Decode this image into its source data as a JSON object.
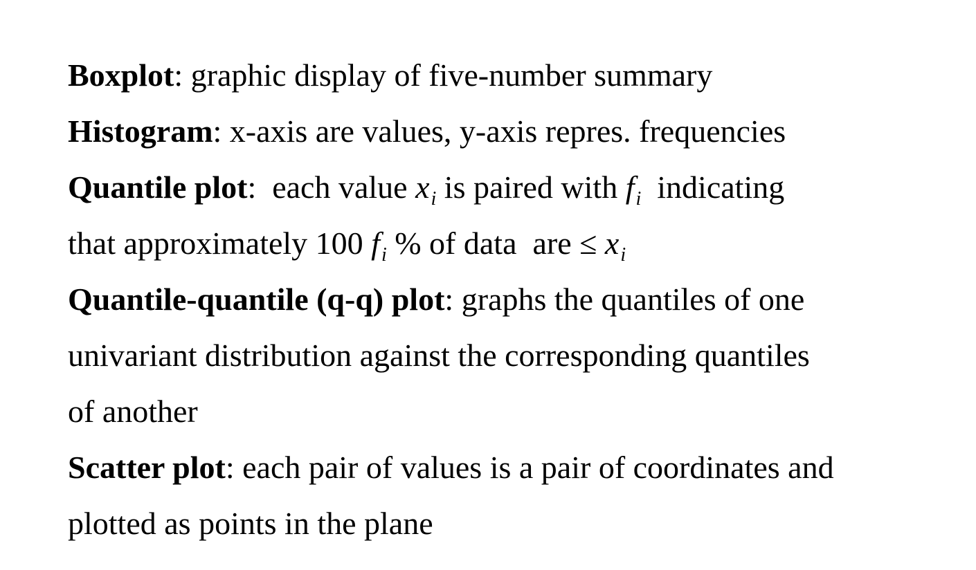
{
  "definitions": {
    "boxplot": {
      "term": "Boxplot",
      "sep": ":",
      "desc": " graphic display of five-number summary"
    },
    "histogram": {
      "term": "Histogram",
      "sep": ":",
      "desc": " x-axis are values, y-axis repres. frequencies"
    },
    "quantile": {
      "term": "Quantile plot",
      "sep": ":",
      "desc_a": "  each value ",
      "var_x": "x",
      "sub_i": "i",
      "desc_b": " is paired with ",
      "var_f": "f",
      "desc_c": "  indicating",
      "line2_a": "that approximately 100 ",
      "line2_b": " % of data  are ≤ "
    },
    "qq": {
      "term": "Quantile-quantile (q-q) plot",
      "sep": ":",
      "desc_1": " graphs the quantiles of one",
      "desc_2": "univariant distribution against the corresponding quantiles",
      "desc_3": "of another"
    },
    "scatter": {
      "term": "Scatter plot",
      "sep": ":",
      "desc_1": " each pair of values is a pair of coordinates and",
      "desc_2": "plotted as points in the plane"
    }
  }
}
